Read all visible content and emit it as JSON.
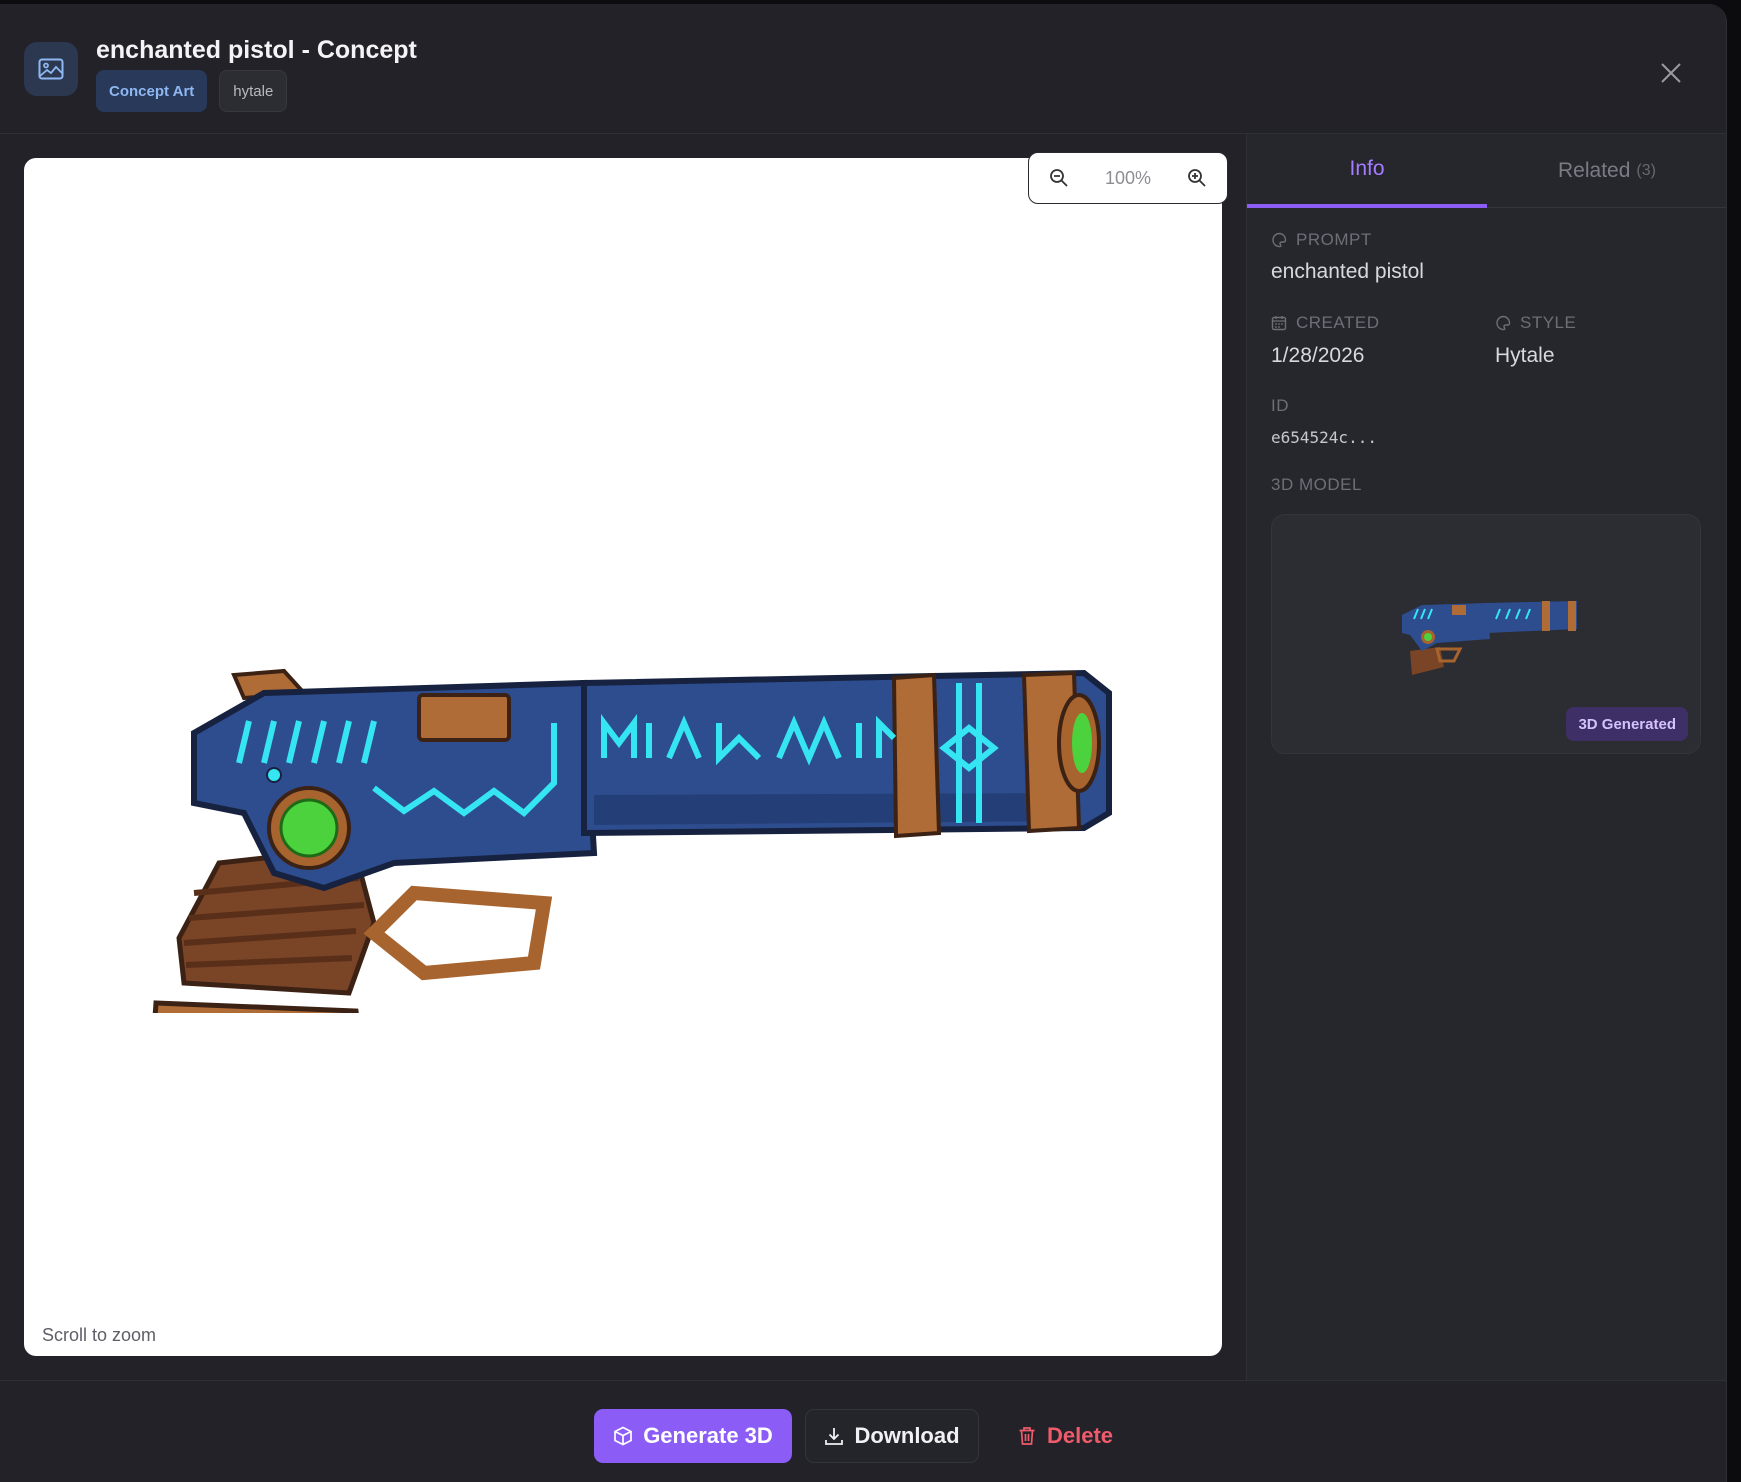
{
  "header": {
    "title": "enchanted pistol - Concept",
    "tags": [
      "Concept Art",
      "hytale"
    ]
  },
  "viewer": {
    "zoom_level": "100%",
    "scroll_hint": "Scroll to zoom"
  },
  "sidebar": {
    "tabs": {
      "info": "Info",
      "related": "Related",
      "related_count": "(3)"
    },
    "prompt_label": "PROMPT",
    "prompt_value": "enchanted pistol",
    "created_label": "CREATED",
    "created_value": "1/28/2026",
    "style_label": "STYLE",
    "style_value": "Hytale",
    "id_label": "ID",
    "id_value": "e654524c...",
    "model_label": "3D MODEL",
    "model_badge": "3D Generated"
  },
  "footer": {
    "generate_label": "Generate 3D",
    "download_label": "Download",
    "delete_label": "Delete"
  },
  "colors": {
    "accent": "#8b5cf6",
    "tag_primary_bg": "#28395a",
    "delete": "#f05b6b",
    "background": "#222228"
  }
}
